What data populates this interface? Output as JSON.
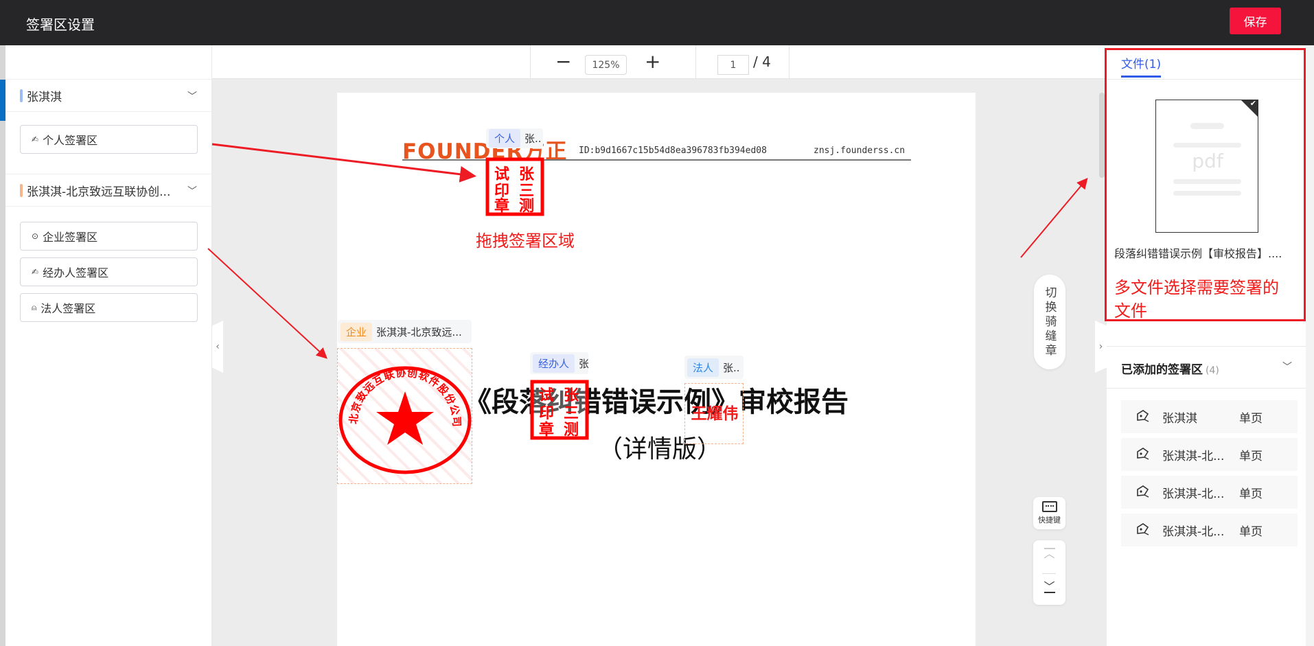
{
  "header": {
    "title": "签署区设置",
    "save_label": "保存"
  },
  "left": {
    "groups": [
      {
        "name": "张淇淇",
        "color": "#9cbcf5",
        "zones": [
          {
            "icon": "pen-sign-icon",
            "label": "个人签署区"
          }
        ]
      },
      {
        "name": "张淇淇-北京致远互联协创...",
        "color": "#f7b58e",
        "zones": [
          {
            "icon": "seal-circle-icon",
            "label": "企业签署区"
          },
          {
            "icon": "pen-sign-icon",
            "label": "经办人签署区"
          },
          {
            "icon": "stamp-icon",
            "label": "法人签署区"
          }
        ]
      }
    ]
  },
  "toolbar": {
    "zoom_out": "−",
    "zoom": "125%",
    "zoom_in": "+",
    "page": "1",
    "page_total": "/ 4"
  },
  "document": {
    "logo": "FOUNDER方正",
    "doc_id": "ID:b9d1667c15b54d8ea396783fb394ed08",
    "domain": "znsj.founderss.cn",
    "title": "《段落纠错错误示例》审校报告",
    "subtitle": "（详情版）",
    "annotation_drag": "拖拽签署区域",
    "fields": [
      {
        "badge": "个人",
        "name": "张..",
        "badge_bg": "#e3e9fb",
        "badge_color": "#3a62e0"
      },
      {
        "badge": "企业",
        "name": "张淇淇-北京致远...",
        "badge_bg": "#fdebd6",
        "badge_color": "#f08a1c"
      },
      {
        "badge": "经办人",
        "name": "张",
        "badge_bg": "#e3e9fb",
        "badge_color": "#3a62e0"
      },
      {
        "badge": "法人",
        "name": "张..",
        "badge_bg": "#e1ecfb",
        "badge_color": "#2f86e6"
      }
    ],
    "stamps": {
      "personal": [
        "试",
        "张",
        "印",
        "三",
        "章",
        "测"
      ],
      "corporate_ring": "北京致远互联协创软件股份公司",
      "legal": "王耀伟"
    }
  },
  "side_controls": {
    "seam_seal": "切换骑缝章",
    "shortcut": "快捷键"
  },
  "right": {
    "tab": "文件(1)",
    "thumb_label": "pdf",
    "file_name": "段落纠错错误示例【审校报告】....",
    "annotation_multi": "多文件选择需要签署的文件",
    "added_title": "已添加的签署区",
    "added_count": "(4)",
    "added": [
      {
        "name": "张淇淇",
        "scope": "单页"
      },
      {
        "name": "张淇淇-北...",
        "scope": "单页"
      },
      {
        "name": "张淇淇-北...",
        "scope": "单页"
      },
      {
        "name": "张淇淇-北...",
        "scope": "单页"
      }
    ]
  },
  "colors": {
    "accent": "#2f5be8",
    "save": "#f5143c",
    "annotation": "#ed1c24",
    "header": "#262628"
  }
}
